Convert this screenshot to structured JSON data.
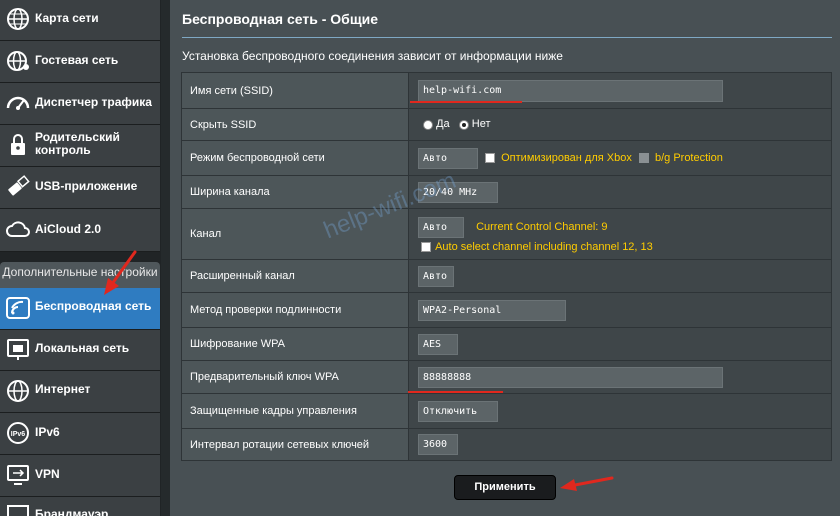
{
  "sidebar": {
    "items": [
      {
        "label": "Карта сети"
      },
      {
        "label": "Гостевая сеть"
      },
      {
        "label": "Диспетчер трафика"
      },
      {
        "label": "Родительский\nконтроль"
      },
      {
        "label": "USB-приложение"
      },
      {
        "label": "AiCloud 2.0"
      }
    ],
    "section_header": "Дополнительные настройки",
    "advanced_items": [
      {
        "label": "Беспроводная сеть",
        "active": true
      },
      {
        "label": "Локальная сеть"
      },
      {
        "label": "Интернет"
      },
      {
        "label": "IPv6"
      },
      {
        "label": "VPN"
      },
      {
        "label": "Брандмауэр"
      }
    ]
  },
  "main": {
    "title": "Беспроводная сеть - Общие",
    "description": "Установка беспроводного соединения зависит от информации ниже",
    "rows": {
      "ssid": {
        "label": "Имя сети (SSID)",
        "value": "help-wifi.com"
      },
      "hide_ssid": {
        "label": "Скрыть SSID",
        "opt_yes": "Да",
        "opt_no": "Нет",
        "selected": "Нет"
      },
      "mode": {
        "label": "Режим беспроводной сети",
        "value": "Авто",
        "xbox_label": "Оптимизирован для Xbox",
        "bg_label": "b/g Protection"
      },
      "bandwidth": {
        "label": "Ширина канала",
        "value": "20/40 MHz"
      },
      "channel": {
        "label": "Канал",
        "value": "Авто",
        "current": "Current Control Channel: 9",
        "auto_label": "Auto select channel including channel 12, 13"
      },
      "ext_channel": {
        "label": "Расширенный канал",
        "value": "Авто"
      },
      "auth": {
        "label": "Метод проверки подлинности",
        "value": "WPA2-Personal"
      },
      "wpa_enc": {
        "label": "Шифрование WPA",
        "value": "AES"
      },
      "wpa_key": {
        "label": "Предварительный ключ WPA",
        "value": "88888888"
      },
      "pmf": {
        "label": "Защищенные кадры управления",
        "value": "Отключить"
      },
      "rekey": {
        "label": "Интервал ротации сетевых ключей",
        "value": "3600"
      }
    },
    "apply_label": "Применить"
  },
  "watermark": "help-wifi.com",
  "colors": {
    "accent": "#2f7cc1",
    "highlight": "#ffcc00",
    "annotation": "#e0281e"
  }
}
